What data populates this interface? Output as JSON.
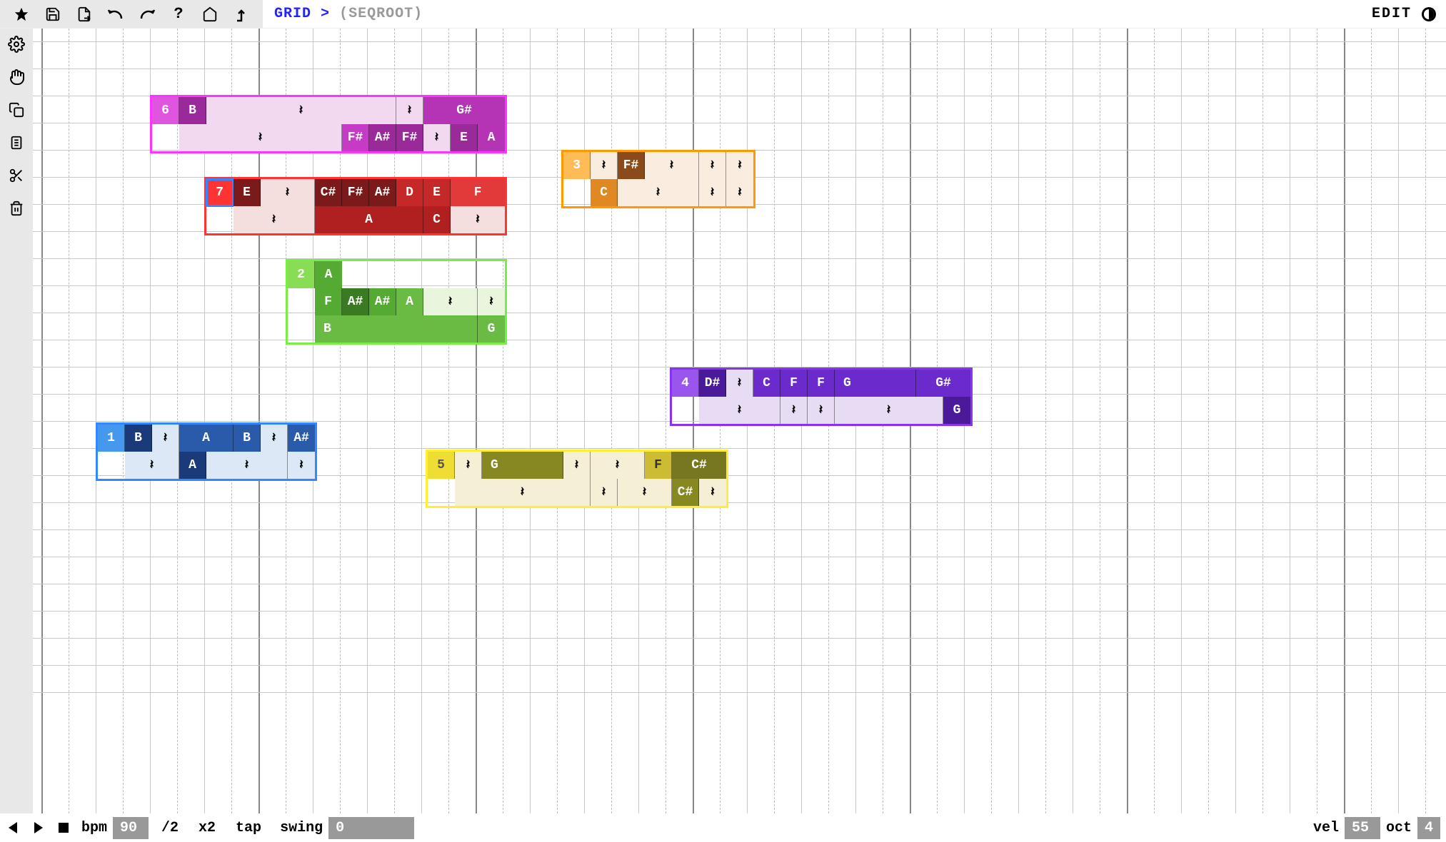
{
  "breadcrumb": {
    "grid": "GRID",
    "gt": ">",
    "path": "(SEQROOT)"
  },
  "topbar_right": {
    "edit": "EDIT"
  },
  "bottombar": {
    "bpm_label": "bpm",
    "bpm_value": "90",
    "half": "/2",
    "dbl": "x2",
    "tap": "tap",
    "swing_label": "swing",
    "swing_value": "0",
    "vel_label": "vel",
    "vel_value": "55",
    "oct_label": "oct",
    "oct_value": "4"
  },
  "clips": {
    "c6": {
      "num": "6",
      "row1": [
        "B",
        "𝄽",
        "𝄽",
        "G#"
      ],
      "row2": [
        "𝄽",
        "F#",
        "A#",
        "F#",
        "𝄽",
        "E",
        "A"
      ]
    },
    "c3": {
      "num": "3",
      "row1": [
        "𝄽",
        "F#",
        "𝄽",
        "𝄽",
        "𝄽"
      ],
      "row2": [
        "C",
        "𝄽",
        "𝄽",
        "𝄽"
      ]
    },
    "c7": {
      "num": "7",
      "row1": [
        "E",
        "𝄽",
        "C#",
        "F#",
        "A#",
        "D",
        "E",
        "F"
      ],
      "row2": [
        "𝄽",
        "A",
        "C",
        "𝄽"
      ]
    },
    "c2": {
      "num": "2",
      "row1": [
        "A"
      ],
      "row2": [
        "F",
        "A#",
        "A#",
        "A",
        "𝄽",
        "𝄽"
      ],
      "row3": [
        "B",
        "G"
      ]
    },
    "c4": {
      "num": "4",
      "row1": [
        "D#",
        "𝄽",
        "C",
        "F",
        "F",
        "G",
        "G#"
      ],
      "row2": [
        "𝄽",
        "𝄽",
        "𝄽",
        "𝄽",
        "G"
      ]
    },
    "c1": {
      "num": "1",
      "row1": [
        "B",
        "𝄽",
        "A",
        "B",
        "𝄽",
        "A#"
      ],
      "row2": [
        "𝄽",
        "A",
        "𝄽",
        "𝄽"
      ]
    },
    "c5": {
      "num": "5",
      "row1": [
        "𝄽",
        "G",
        "𝄽",
        "𝄽",
        "F",
        "C#"
      ],
      "row2": [
        "𝄽",
        "𝄽",
        "𝄽",
        "C#",
        "𝄽"
      ]
    }
  }
}
